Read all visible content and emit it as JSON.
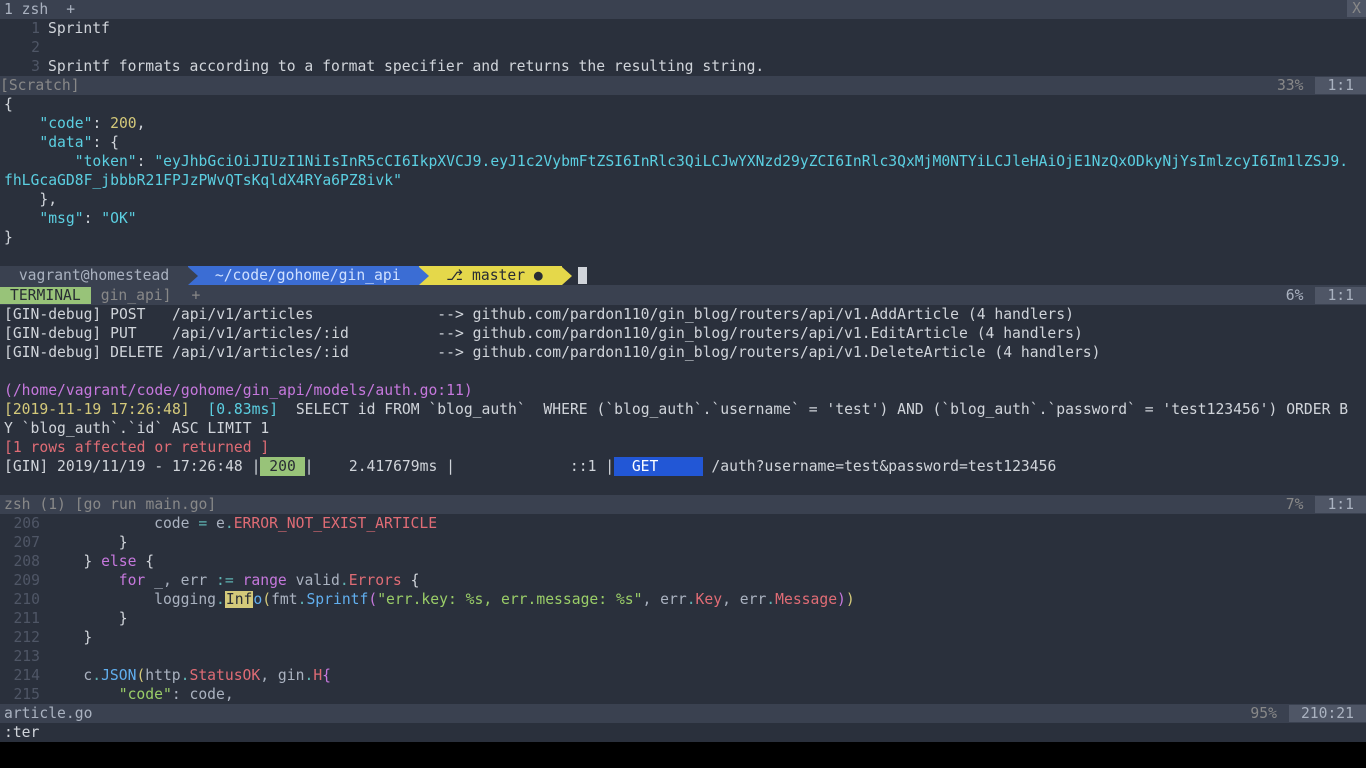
{
  "tmux": {
    "tab_active": "1 zsh",
    "plus": "+",
    "close": "X"
  },
  "scratch": {
    "lines": [
      {
        "n": "1",
        "t": "Sprintf"
      },
      {
        "n": "2",
        "t": ""
      },
      {
        "n": "3",
        "t": "Sprintf formats according to a format specifier and returns the resulting string."
      }
    ],
    "label": "[Scratch]",
    "pct": "33%",
    "pos": "1:1"
  },
  "json_preview": {
    "open": "{",
    "code_key": "\"code\"",
    "code_sep": ": ",
    "code_val": "200",
    "code_end": ",",
    "data_key": "\"data\"",
    "data_sep": ": {",
    "token_key": "\"token\"",
    "token_sep": ": ",
    "token_val": "\"eyJhbGciOiJIUzI1NiIsInR5cCI6IkpXVCJ9.eyJ1c2VybmFtZSI6InRlc3QiLCJwYXNzd29yZCI6InRlc3QxMjM0NTYiLCJleHAiOjE1NzQxODkyNjYsImlzcyI6Im1lZSJ9.fhLGcaGD8F_jbbbR21FPJzPWvQTsKqldX4RYa6PZ8ivk\"",
    "data_close": "},",
    "msg_key": "\"msg\"",
    "msg_sep": ": ",
    "msg_val": "\"OK\"",
    "close": "}"
  },
  "prompt": {
    "user": " vagrant@homestead ",
    "path": " ~/code/gohome/gin_api ",
    "branch": " ⎇ master ● "
  },
  "mid_status": {
    "pct": "6%",
    "pos": "1:1"
  },
  "term_tabs": {
    "active": " TERMINAL ",
    "t2": "gin_api]",
    "t3": "+"
  },
  "routes": [
    {
      "pre": "[GIN-debug] POST   /api/v1/articles              --> github.com/pardon110/gin_blog/routers/api/v1.AddArticle (4 handlers)"
    },
    {
      "pre": "[GIN-debug] PUT    /api/v1/articles/:id          --> github.com/pardon110/gin_blog/routers/api/v1.EditArticle (4 handlers)"
    },
    {
      "pre": "[GIN-debug] DELETE /api/v1/articles/:id          --> github.com/pardon110/gin_blog/routers/api/v1.DeleteArticle (4 handlers)"
    }
  ],
  "auth_path": "(/home/vagrant/code/gohome/gin_api/models/auth.go:11)",
  "sql_ts": "[2019-11-19 17:26:48]  ",
  "sql_dur": "[0.83ms]",
  "sql_body": "  SELECT id FROM `blog_auth`  WHERE (`blog_auth`.`username` = 'test') AND (`blog_auth`.`password` = 'test123456') ORDER BY `blog_auth`.`id` ASC LIMIT 1",
  "rows_aff": "[1 rows affected or returned ]",
  "gin_log": {
    "p1": "[GIN] 2019/11/19 - 17:26:48 |",
    "status": " 200 ",
    "p2": "|    2.417679ms |             ::1 |",
    "method": "  GET     ",
    "p3": " /auth?username=test&password=test123456"
  },
  "code_status": {
    "label": "zsh (1) [go run main.go]",
    "pct": "7%",
    "pos": "1:1"
  },
  "code_lines": [
    {
      "n": "206",
      "seg": [
        {
          "c": "",
          "t": "            code "
        },
        {
          "c": "c-teal",
          "t": "="
        },
        {
          "c": "",
          "t": " e"
        },
        {
          "c": "c-teal",
          "t": "."
        },
        {
          "c": "c-red",
          "t": "ERROR_NOT_EXIST_ARTICLE"
        }
      ]
    },
    {
      "n": "207",
      "seg": [
        {
          "c": "c-white",
          "t": "        }"
        }
      ]
    },
    {
      "n": "208",
      "seg": [
        {
          "c": "c-white",
          "t": "    } "
        },
        {
          "c": "c-mag",
          "t": "else"
        },
        {
          "c": "c-white",
          "t": " {"
        }
      ]
    },
    {
      "n": "209",
      "seg": [
        {
          "c": "",
          "t": "        "
        },
        {
          "c": "c-mag",
          "t": "for"
        },
        {
          "c": "",
          "t": " _, err "
        },
        {
          "c": "c-teal",
          "t": ":="
        },
        {
          "c": "",
          "t": " "
        },
        {
          "c": "c-mag",
          "t": "range"
        },
        {
          "c": "",
          "t": " valid"
        },
        {
          "c": "c-teal",
          "t": "."
        },
        {
          "c": "c-red",
          "t": "Errors"
        },
        {
          "c": "c-white",
          "t": " {"
        }
      ]
    },
    {
      "n": "210",
      "seg": [
        {
          "c": "",
          "t": "            logging"
        },
        {
          "c": "c-teal",
          "t": "."
        },
        {
          "c": "hl-cursor",
          "t": "Inf"
        },
        {
          "c": "c-blue",
          "t": "o"
        },
        {
          "c": "c-yellow",
          "t": "("
        },
        {
          "c": "",
          "t": "fmt"
        },
        {
          "c": "c-teal",
          "t": "."
        },
        {
          "c": "c-blue",
          "t": "Sprintf"
        },
        {
          "c": "c-mag",
          "t": "("
        },
        {
          "c": "c-green",
          "t": "\"err.key: %s, err.message: %s\""
        },
        {
          "c": "",
          "t": ", err"
        },
        {
          "c": "c-teal",
          "t": "."
        },
        {
          "c": "c-red",
          "t": "Key"
        },
        {
          "c": "",
          "t": ", err"
        },
        {
          "c": "c-teal",
          "t": "."
        },
        {
          "c": "c-red",
          "t": "Message"
        },
        {
          "c": "c-mag",
          "t": ")"
        },
        {
          "c": "c-yellow",
          "t": ")"
        }
      ]
    },
    {
      "n": "211",
      "seg": [
        {
          "c": "c-white",
          "t": "        }"
        }
      ]
    },
    {
      "n": "212",
      "seg": [
        {
          "c": "c-white",
          "t": "    }"
        }
      ]
    },
    {
      "n": "213",
      "seg": [
        {
          "c": "",
          "t": ""
        }
      ]
    },
    {
      "n": "214",
      "seg": [
        {
          "c": "",
          "t": "    c"
        },
        {
          "c": "c-teal",
          "t": "."
        },
        {
          "c": "c-blue",
          "t": "JSON"
        },
        {
          "c": "c-yellow",
          "t": "("
        },
        {
          "c": "",
          "t": "http"
        },
        {
          "c": "c-teal",
          "t": "."
        },
        {
          "c": "c-red",
          "t": "StatusOK"
        },
        {
          "c": "",
          "t": ", gin"
        },
        {
          "c": "c-teal",
          "t": "."
        },
        {
          "c": "c-red",
          "t": "H"
        },
        {
          "c": "c-mag",
          "t": "{"
        }
      ]
    },
    {
      "n": "215",
      "seg": [
        {
          "c": "",
          "t": "        "
        },
        {
          "c": "c-green",
          "t": "\"code\""
        },
        {
          "c": "",
          "t": ": code,"
        }
      ]
    }
  ],
  "file_status": {
    "name": "article.go",
    "pct": "95%",
    "pos": "210:21"
  },
  "cmd": ":ter"
}
